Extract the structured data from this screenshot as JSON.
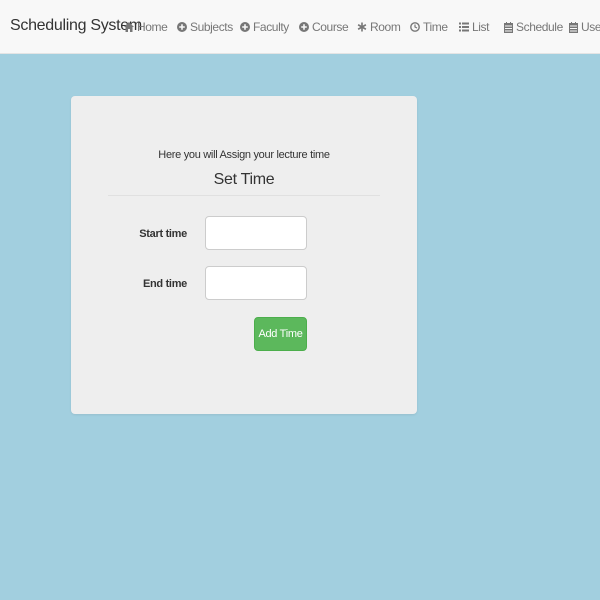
{
  "navbar": {
    "brand": "Scheduling System",
    "items": [
      {
        "label": "Home",
        "icon": "home-icon"
      },
      {
        "label": "Subjects",
        "icon": "circle-plus-icon"
      },
      {
        "label": "Faculty",
        "icon": "circle-plus-icon"
      },
      {
        "label": "Course",
        "icon": "circle-plus-icon"
      },
      {
        "label": "Room",
        "icon": "asterisk-icon"
      },
      {
        "label": "Time",
        "icon": "clock-icon"
      },
      {
        "label": "List",
        "icon": "list-icon"
      },
      {
        "label": "Schedule",
        "icon": "calendar-icon"
      },
      {
        "label": "User",
        "icon": "calendar-icon"
      }
    ]
  },
  "form": {
    "subtitle": "Here you will Assign your lecture time",
    "title": "Set Time",
    "start_label": "Start time",
    "start_value": "",
    "end_label": "End time",
    "end_value": "",
    "submit_label": "Add Time"
  },
  "colors": {
    "background": "#a2cfdf",
    "navbar": "#f8f8f8",
    "card": "#eeeeee",
    "button": "#5cb85c"
  }
}
